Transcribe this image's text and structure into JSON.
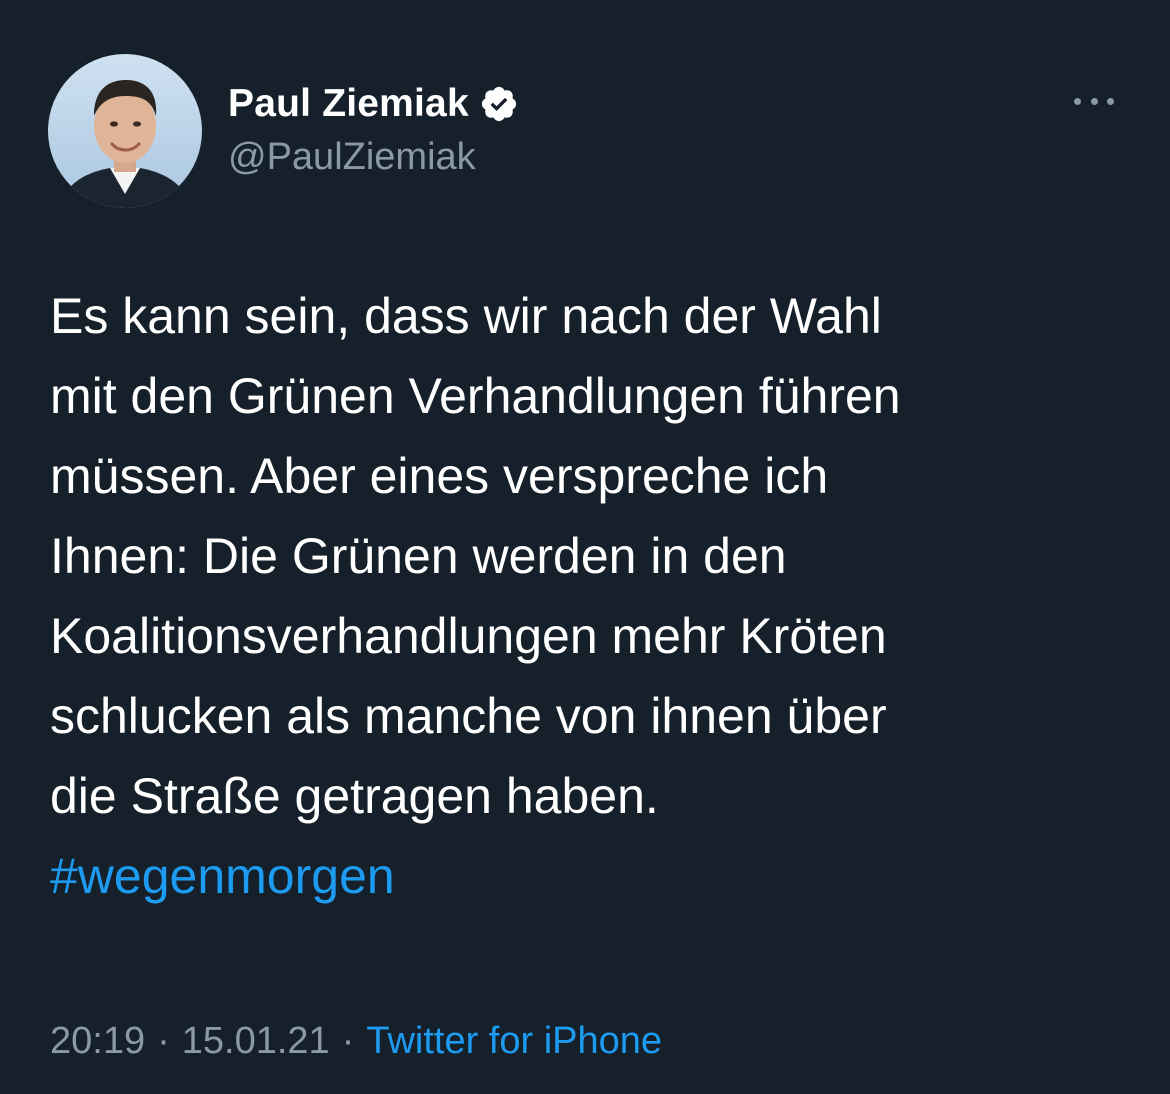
{
  "author": {
    "name": "Paul Ziemiak",
    "handle": "@PaulZiemiak",
    "avatar_icon": "profile-photo",
    "verified_icon": "verified-badge-icon"
  },
  "more_icon": "more-options-icon",
  "tweet": {
    "lines": [
      "Es kann sein, dass wir nach der Wahl",
      "mit den Grünen Verhandlungen führen",
      "müssen. Aber eines verspreche ich",
      "Ihnen: Die Grünen werden in den",
      "Koalitionsverhandlungen mehr Kröten",
      "schlucken als manche von ihnen über",
      "die Straße getragen haben."
    ],
    "hashtag": "#wegenmorgen"
  },
  "meta": {
    "time": "20:19",
    "separator": "·",
    "date": "15.01.21",
    "source": "Twitter for iPhone"
  },
  "colors": {
    "background": "#15202b",
    "text": "#ffffff",
    "secondary_text": "#8b98a5",
    "accent": "#1d9bf0"
  }
}
